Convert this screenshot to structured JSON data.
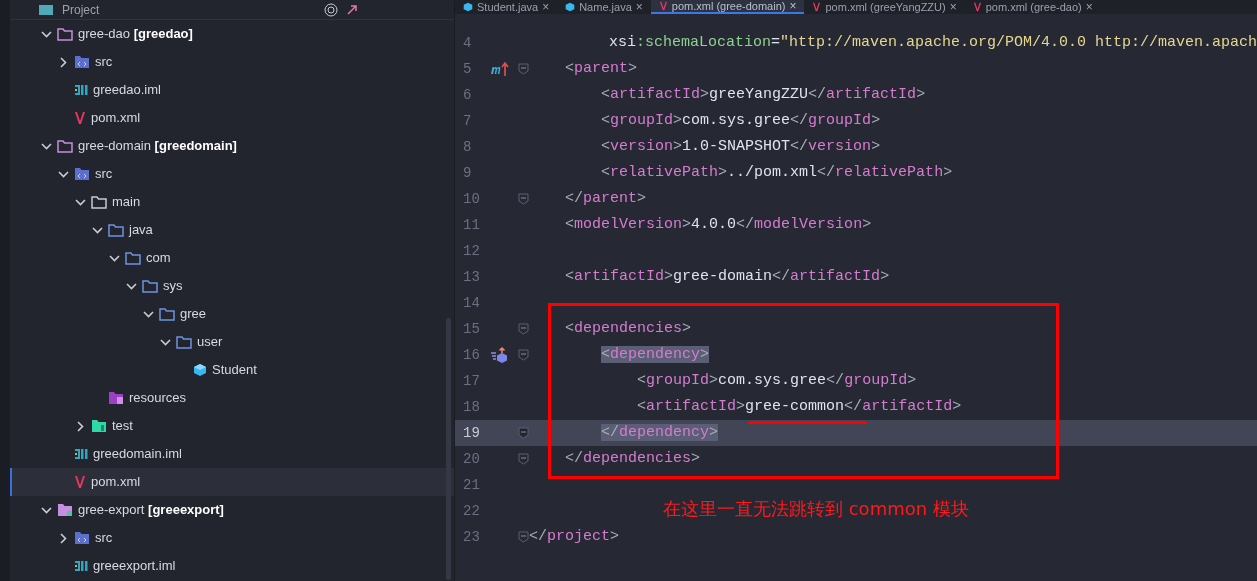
{
  "project_panel": {
    "title": "Project",
    "tree": [
      {
        "label": "gree-dao **[greedao]**",
        "kind": "module",
        "expanded": true,
        "selected": false,
        "children": [
          {
            "label": "src",
            "kind": "src",
            "expanded": false,
            "selected": false
          },
          {
            "label": "greedao.iml",
            "kind": "iml",
            "selected": false
          },
          {
            "label": "pom.xml",
            "kind": "maven",
            "selected": false
          }
        ]
      },
      {
        "label": "gree-domain **[greedomain]**",
        "kind": "module",
        "expanded": true,
        "selected": false,
        "children": [
          {
            "label": "src",
            "kind": "src",
            "expanded": true,
            "selected": false,
            "children": [
              {
                "label": "main",
                "kind": "folder",
                "expanded": true,
                "selected": false,
                "children": [
                  {
                    "label": "java",
                    "kind": "source",
                    "expanded": true,
                    "selected": false,
                    "children": [
                      {
                        "label": "com",
                        "kind": "source",
                        "expanded": true,
                        "selected": false,
                        "children": [
                          {
                            "label": "sys",
                            "kind": "source",
                            "expanded": true,
                            "selected": false,
                            "children": [
                              {
                                "label": "gree",
                                "kind": "source",
                                "expanded": true,
                                "selected": false,
                                "children": [
                                  {
                                    "label": "user",
                                    "kind": "source",
                                    "expanded": true,
                                    "selected": false,
                                    "children": [
                                      {
                                        "label": "Student",
                                        "kind": "class",
                                        "selected": false
                                      }
                                    ]
                                  }
                                ]
                              }
                            ]
                          }
                        ]
                      }
                    ]
                  },
                  {
                    "label": "resources",
                    "kind": "resources",
                    "selected": false
                  }
                ]
              },
              {
                "label": "test",
                "kind": "test",
                "expanded": false,
                "selected": false
              }
            ]
          },
          {
            "label": "greedomain.iml",
            "kind": "iml",
            "selected": false
          },
          {
            "label": "pom.xml",
            "kind": "maven",
            "selected": true
          }
        ]
      },
      {
        "label": "gree-export **[greeexport]**",
        "kind": "export",
        "expanded": true,
        "selected": false,
        "children": [
          {
            "label": "src",
            "kind": "src",
            "expanded": false,
            "selected": false
          },
          {
            "label": "greeexport.iml",
            "kind": "iml",
            "selected": false
          }
        ]
      }
    ]
  },
  "editor": {
    "tabs": [
      {
        "label": "Student.java",
        "kind": "class",
        "close": "×",
        "selected": false
      },
      {
        "label": "Name.java",
        "kind": "class",
        "close": "×",
        "selected": false
      },
      {
        "label": "pom.xml (gree-domain)",
        "kind": "maven",
        "close": "×",
        "selected": true
      },
      {
        "label": "pom.xml (greeYangZZU)",
        "kind": "maven",
        "close": "×",
        "selected": false
      },
      {
        "label": "pom.xml (gree-dao)",
        "kind": "maven",
        "close": "×",
        "selected": false
      }
    ],
    "lines": [
      {
        "number": "4",
        "current": false,
        "fold": false,
        "segments": [
          {
            "t": "         xsi",
            "kind": "text"
          },
          {
            "t": ":schemaLocation",
            "kind": "attr"
          },
          {
            "t": "=",
            "kind": "text"
          },
          {
            "t": "\"http://maven.apache.org/POM/4.0.0 http://maven.apach",
            "kind": "str"
          }
        ]
      },
      {
        "number": "5",
        "current": false,
        "gutter": {
          "kind": "maven-parent"
        },
        "fold": true,
        "segments": [
          {
            "t": "    <",
            "kind": "punct"
          },
          {
            "t": "parent",
            "kind": "tag"
          },
          {
            "t": ">",
            "kind": "punct"
          }
        ]
      },
      {
        "number": "6",
        "current": false,
        "fold": false,
        "segments": [
          {
            "t": "        <",
            "kind": "punct"
          },
          {
            "t": "artifactId",
            "kind": "tag"
          },
          {
            "t": ">",
            "kind": "punct"
          },
          {
            "t": "greeYangZZU",
            "kind": "text"
          },
          {
            "t": "</",
            "kind": "punct"
          },
          {
            "t": "artifactId",
            "kind": "tag"
          },
          {
            "t": ">",
            "kind": "punct"
          }
        ]
      },
      {
        "number": "7",
        "current": false,
        "fold": false,
        "segments": [
          {
            "t": "        <",
            "kind": "punct"
          },
          {
            "t": "groupId",
            "kind": "tag"
          },
          {
            "t": ">",
            "kind": "punct"
          },
          {
            "t": "com.sys.gree",
            "kind": "text"
          },
          {
            "t": "</",
            "kind": "punct"
          },
          {
            "t": "groupId",
            "kind": "tag"
          },
          {
            "t": ">",
            "kind": "punct"
          }
        ]
      },
      {
        "number": "8",
        "current": false,
        "fold": false,
        "segments": [
          {
            "t": "        <",
            "kind": "punct"
          },
          {
            "t": "version",
            "kind": "tag"
          },
          {
            "t": ">",
            "kind": "punct"
          },
          {
            "t": "1.0-SNAPSHOT",
            "kind": "text"
          },
          {
            "t": "</",
            "kind": "punct"
          },
          {
            "t": "version",
            "kind": "tag"
          },
          {
            "t": ">",
            "kind": "punct"
          }
        ]
      },
      {
        "number": "9",
        "current": false,
        "fold": false,
        "segments": [
          {
            "t": "        <",
            "kind": "punct"
          },
          {
            "t": "relativePath",
            "kind": "tag"
          },
          {
            "t": ">",
            "kind": "punct"
          },
          {
            "t": "../pom.xml",
            "kind": "text"
          },
          {
            "t": "</",
            "kind": "punct"
          },
          {
            "t": "relativePath",
            "kind": "tag"
          },
          {
            "t": ">",
            "kind": "punct"
          }
        ]
      },
      {
        "number": "10",
        "current": false,
        "fold": true,
        "segments": [
          {
            "t": "    </",
            "kind": "punct"
          },
          {
            "t": "parent",
            "kind": "tag"
          },
          {
            "t": ">",
            "kind": "punct"
          }
        ]
      },
      {
        "number": "11",
        "current": false,
        "fold": false,
        "segments": [
          {
            "t": "    <",
            "kind": "punct"
          },
          {
            "t": "modelVersion",
            "kind": "tag"
          },
          {
            "t": ">",
            "kind": "punct"
          },
          {
            "t": "4.0.0",
            "kind": "text"
          },
          {
            "t": "</",
            "kind": "punct"
          },
          {
            "t": "modelVersion",
            "kind": "tag"
          },
          {
            "t": ">",
            "kind": "punct"
          }
        ]
      },
      {
        "number": "12",
        "current": false,
        "fold": false
      },
      {
        "number": "13",
        "current": false,
        "fold": false,
        "segments": [
          {
            "t": "    <",
            "kind": "punct"
          },
          {
            "t": "artifactId",
            "kind": "tag"
          },
          {
            "t": ">",
            "kind": "punct"
          },
          {
            "t": "gree-domain",
            "kind": "text"
          },
          {
            "t": "</",
            "kind": "punct"
          },
          {
            "t": "artifactId",
            "kind": "tag"
          },
          {
            "t": ">",
            "kind": "punct"
          }
        ]
      },
      {
        "number": "14",
        "current": false,
        "fold": false
      },
      {
        "number": "15",
        "current": false,
        "fold": true,
        "segments": [
          {
            "t": "    <",
            "kind": "punct"
          },
          {
            "t": "dependencies",
            "kind": "tag"
          },
          {
            "t": ">",
            "kind": "punct"
          }
        ]
      },
      {
        "number": "16",
        "current": false,
        "gutter": {
          "kind": "dependency"
        },
        "fold": true,
        "segments": [
          {
            "t": "        <",
            "kind": "punct",
            "selected": true
          },
          {
            "t": "dependency",
            "kind": "tag",
            "selected": true
          },
          {
            "t": ">",
            "kind": "punct",
            "selected": true
          }
        ]
      },
      {
        "number": "17",
        "current": false,
        "fold": false,
        "segments": [
          {
            "t": "            <",
            "kind": "punct"
          },
          {
            "t": "groupId",
            "kind": "tag"
          },
          {
            "t": ">",
            "kind": "punct"
          },
          {
            "t": "com.sys.gree",
            "kind": "text"
          },
          {
            "t": "</",
            "kind": "punct"
          },
          {
            "t": "groupId",
            "kind": "tag"
          },
          {
            "t": ">",
            "kind": "punct"
          }
        ]
      },
      {
        "number": "18",
        "current": false,
        "fold": false,
        "segments": [
          {
            "t": "            <",
            "kind": "punct"
          },
          {
            "t": "artifactId",
            "kind": "tag"
          },
          {
            "t": ">",
            "kind": "punct"
          },
          {
            "t": "gree-common",
            "kind": "text"
          },
          {
            "t": "</",
            "kind": "punct"
          },
          {
            "t": "artifactId",
            "kind": "tag"
          },
          {
            "t": ">",
            "kind": "punct"
          }
        ]
      },
      {
        "number": "19",
        "current": true,
        "fold": true,
        "segments": [
          {
            "t": "        </",
            "kind": "punct",
            "selected": true
          },
          {
            "t": "dependency",
            "kind": "tag",
            "selected": true
          },
          {
            "t": ">",
            "kind": "punct",
            "selected": true
          }
        ]
      },
      {
        "number": "20",
        "current": false,
        "fold": true,
        "segments": [
          {
            "t": "    </",
            "kind": "punct"
          },
          {
            "t": "dependencies",
            "kind": "tag"
          },
          {
            "t": ">",
            "kind": "punct"
          }
        ]
      },
      {
        "number": "21",
        "current": false,
        "fold": false
      },
      {
        "number": "22",
        "current": false,
        "fold": false
      },
      {
        "number": "23",
        "current": false,
        "fold": true,
        "segments": [
          {
            "t": "</",
            "kind": "punct"
          },
          {
            "t": "project",
            "kind": "tag"
          },
          {
            "t": ">",
            "kind": "punct"
          }
        ]
      }
    ],
    "annotation": {
      "note": "在这里一直无法跳转到 common 模块"
    }
  }
}
